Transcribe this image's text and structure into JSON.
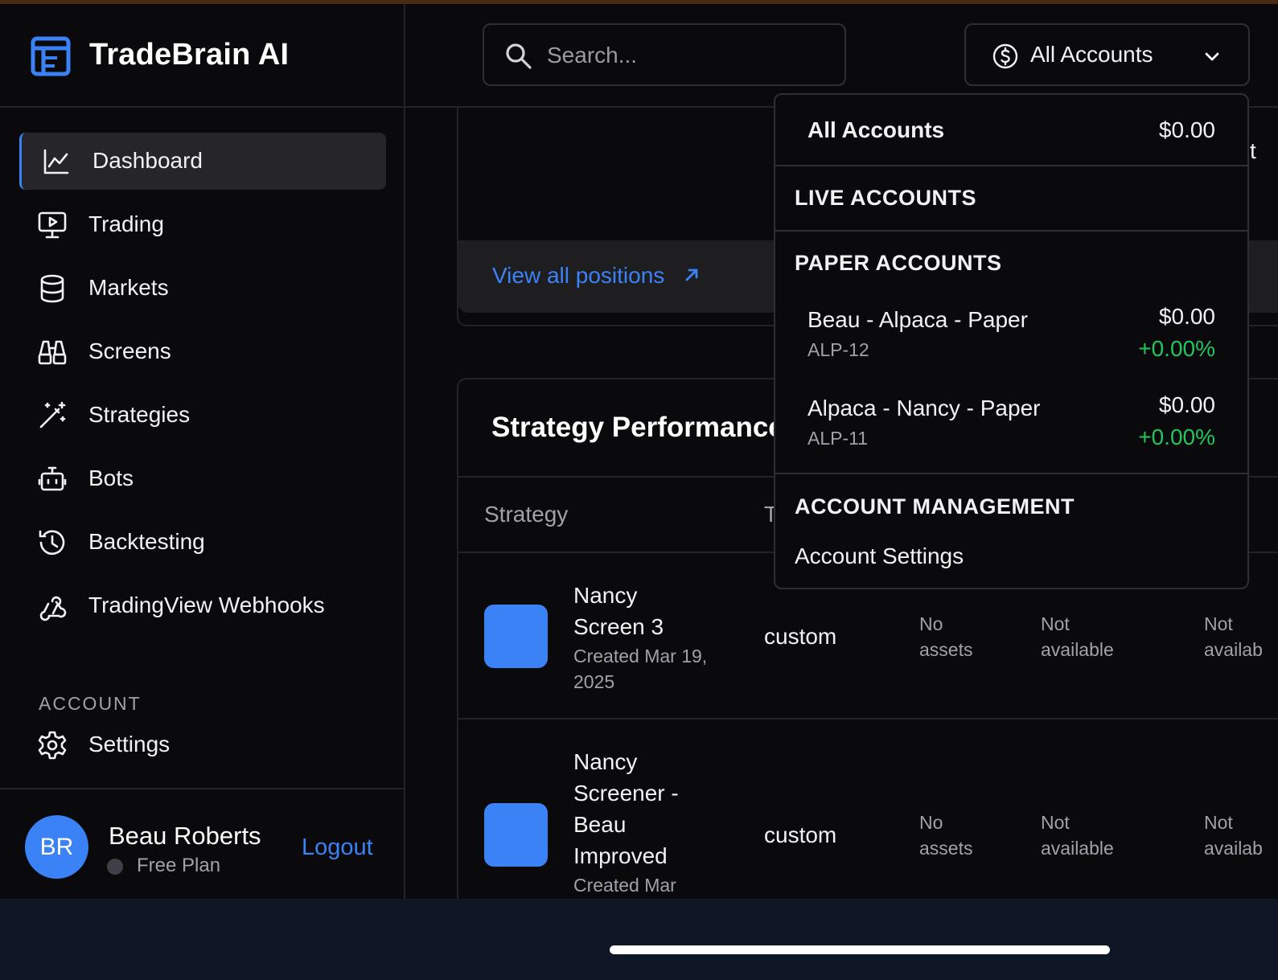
{
  "brand": {
    "name": "TradeBrain AI",
    "accent": "#3b82f6"
  },
  "sidebar": {
    "items": [
      {
        "label": "Dashboard",
        "icon": "chart-line-icon",
        "active": true
      },
      {
        "label": "Trading",
        "icon": "monitor-play-icon"
      },
      {
        "label": "Markets",
        "icon": "database-icon"
      },
      {
        "label": "Screens",
        "icon": "binoculars-icon"
      },
      {
        "label": "Strategies",
        "icon": "magic-wand-icon"
      },
      {
        "label": "Bots",
        "icon": "bot-icon"
      },
      {
        "label": "Backtesting",
        "icon": "history-icon"
      },
      {
        "label": "TradingView Webhooks",
        "icon": "webhook-icon"
      }
    ],
    "account_section_label": "ACCOUNT",
    "settings_label": "Settings"
  },
  "user": {
    "initials": "BR",
    "name": "Beau Roberts",
    "plan": "Free Plan",
    "logout_label": "Logout"
  },
  "header": {
    "search_placeholder": "Search...",
    "account_select_label": "All Accounts"
  },
  "dropdown": {
    "all_accounts": {
      "label": "All Accounts",
      "value": "$0.00"
    },
    "live_heading": "LIVE ACCOUNTS",
    "paper_heading": "PAPER ACCOUNTS",
    "paper_accounts": [
      {
        "name": "Beau - Alpaca - Paper",
        "id": "ALP-12",
        "value": "$0.00",
        "change": "+0.00%"
      },
      {
        "name": "Alpaca - Nancy - Paper",
        "id": "ALP-11",
        "value": "$0.00",
        "change": "+0.00%"
      }
    ],
    "management_heading": "ACCOUNT MANAGEMENT",
    "settings_label": "Account Settings"
  },
  "positions": {
    "view_all_label": "View all positions"
  },
  "strategy_performance": {
    "title": "Strategy Performance",
    "columns": [
      "Strategy",
      "T"
    ],
    "rows": [
      {
        "name": "Nancy Screen 3",
        "created": "Created Mar 19, 2025",
        "type": "custom",
        "assets": "No assets",
        "col4": "Not available",
        "col5": "Not availab"
      },
      {
        "name": "Nancy Screener - Beau Improved",
        "created": "Created Mar",
        "type": "custom",
        "assets": "No assets",
        "col4": "Not available",
        "col5": "Not availab"
      }
    ]
  },
  "peek_text": "t"
}
